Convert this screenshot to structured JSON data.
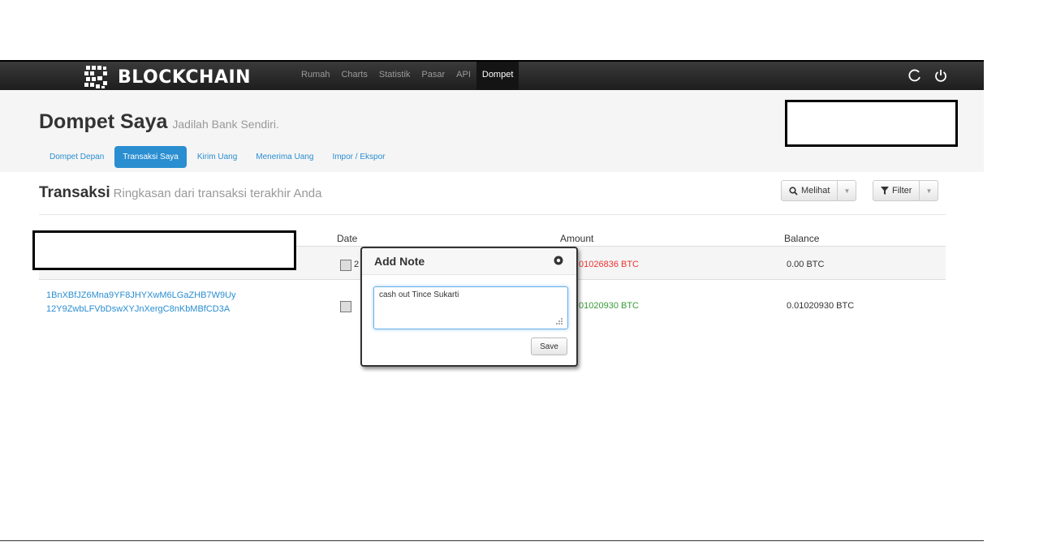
{
  "navbar": {
    "brand": "BLOCKCHAIN",
    "links": [
      {
        "label": "Rumah",
        "active": false
      },
      {
        "label": "Charts",
        "active": false
      },
      {
        "label": "Statistik",
        "active": false
      },
      {
        "label": "Pasar",
        "active": false
      },
      {
        "label": "API",
        "active": false
      },
      {
        "label": "Dompet",
        "active": true
      }
    ],
    "icons": [
      "refresh-icon",
      "power-icon"
    ]
  },
  "header": {
    "title": "Dompet Saya",
    "subtitle": "Jadilah Bank Sendiri.",
    "tabs": [
      {
        "label": "Dompet Depan",
        "active": false
      },
      {
        "label": "Transaksi Saya",
        "active": true
      },
      {
        "label": "Kirim Uang",
        "active": false
      },
      {
        "label": "Menerima Uang",
        "active": false
      },
      {
        "label": "Impor / Ekspor",
        "active": false
      }
    ]
  },
  "section": {
    "title": "Transaksi",
    "subtitle": "Ringkasan dari transaksi terakhir Anda",
    "view_button": "Melihat",
    "filter_button": "Filter"
  },
  "table": {
    "headers": {
      "date": "Date",
      "amount": "Amount",
      "balance": "Balance"
    },
    "rows": [
      {
        "date_fragment": "2",
        "amount": "01026836 BTC",
        "balance": "0.00 BTC",
        "amount_color": "#e33333"
      },
      {
        "addresses": [
          "1BnXBfJZ6Mna9YF8JHYXwM6LGaZHB7W9Uy",
          "12Y9ZwbLFVbDswXYJnXergC8nKbMBfCD3A"
        ],
        "amount": "01020930 BTC",
        "balance": "0.01020930 BTC",
        "amount_color": "#3a9a3a"
      }
    ]
  },
  "popup": {
    "title": "Add Note",
    "note_value": "cash out Tince Sukarti",
    "save_label": "Save"
  }
}
